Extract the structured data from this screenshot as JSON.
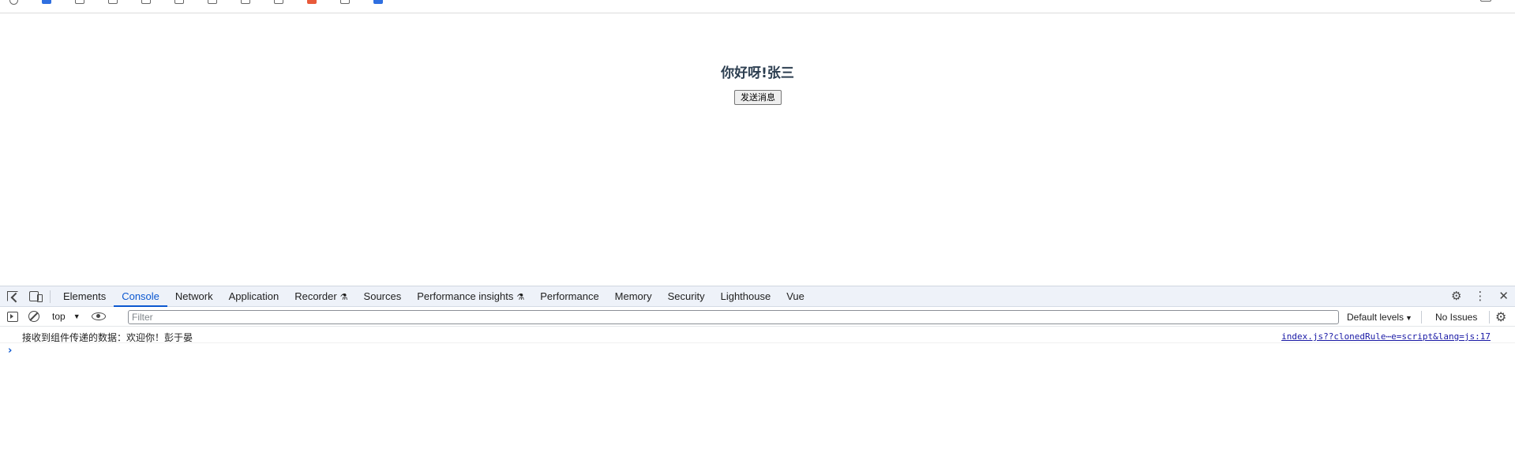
{
  "page": {
    "title": "你好呀!张三",
    "button_label": "发送消息"
  },
  "devtools": {
    "tabs": [
      {
        "label": "Elements"
      },
      {
        "label": "Console"
      },
      {
        "label": "Network"
      },
      {
        "label": "Application"
      },
      {
        "label": "Recorder",
        "icon": "flask-icon"
      },
      {
        "label": "Sources"
      },
      {
        "label": "Performance insights",
        "icon": "flask-icon"
      },
      {
        "label": "Performance"
      },
      {
        "label": "Memory"
      },
      {
        "label": "Security"
      },
      {
        "label": "Lighthouse"
      },
      {
        "label": "Vue"
      }
    ],
    "active_tab": "Console",
    "toolbar": {
      "context": "top",
      "filter_placeholder": "Filter",
      "levels": "Default levels",
      "issues": "No Issues"
    },
    "console": {
      "message": "接收到组件传递的数据：欢迎你！彭于晏",
      "source": "index.js??clonedRule⋯e=script&lang=js:17"
    }
  },
  "colors": {
    "accent": "#0b57d0",
    "title": "#2c3e50",
    "link": "#1a1aa6"
  }
}
